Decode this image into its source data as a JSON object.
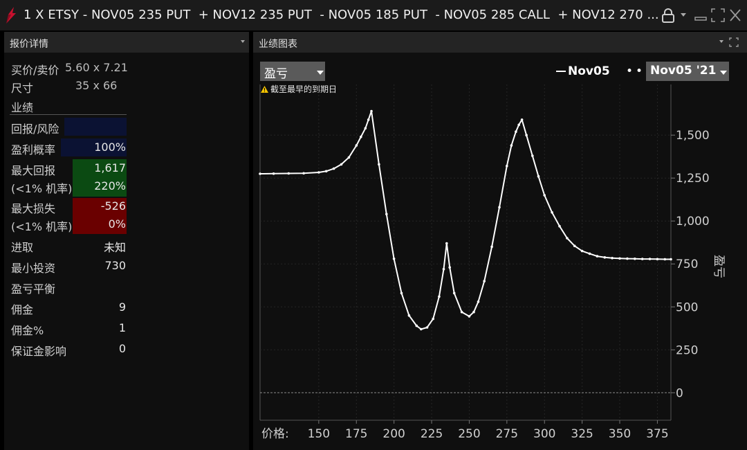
{
  "window": {
    "title": "1 X ETSY - NOV05 235 PUT  + NOV12 235 PUT  - NOV05 185 PUT  - NOV05 285 CALL  + NOV12 270 ..."
  },
  "left_panel": {
    "header": "报价详情",
    "bid_ask_label": "买价/卖价",
    "bid_ask_value": "5.60 x 7.21",
    "size_label": "尺寸",
    "size_value": "35 x 66",
    "performance_label": "业绩",
    "return_risk_label": "回报/风险",
    "return_risk_value": "",
    "prob_profit_label": "盈利概率",
    "prob_profit_value": "100%",
    "max_return_label": "最大回报",
    "max_return_value": "1,617",
    "max_return_prob_label": "(<1% 机率)",
    "max_return_prob_value": "220%",
    "max_loss_label": "最大损失",
    "max_loss_value": "-526",
    "max_loss_prob_label": "(<1% 机率)",
    "max_loss_prob_value": "0%",
    "entry_label": "进取",
    "entry_value": "未知",
    "min_invest_label": "最小投资",
    "min_invest_value": "730",
    "breakeven_label": "盈亏平衡",
    "commission_label": "佣金",
    "commission_value": "9",
    "commission_pct_label": "佣金%",
    "commission_pct_value": "1",
    "margin_label": "保证金影响",
    "margin_value": "0"
  },
  "right_panel": {
    "header": "业绩图表",
    "metric_select": "盈亏",
    "legend_series": "Nov05",
    "date_select": "Nov05 '21",
    "warning": "截至最早的到期日"
  },
  "colors": {
    "positive_green": "#0b4a12",
    "negative_red": "#6a0000",
    "navy": "#0b1233",
    "curve": "#ffffff"
  },
  "chart_data": {
    "type": "line",
    "xlabel": "价格:",
    "ylabel": "盈亏",
    "xlim": [
      111,
      384
    ],
    "ylim": [
      -160,
      1795
    ],
    "xticks": [
      150,
      175,
      200,
      225,
      250,
      275,
      300,
      325,
      350,
      375
    ],
    "yticks": [
      0,
      250,
      500,
      750,
      1000,
      1250,
      1500
    ],
    "ytick_labels": [
      "0",
      "250",
      "500",
      "750",
      "1,000",
      "1,250",
      "1,500"
    ],
    "series": [
      {
        "name": "Nov05",
        "x": [
          111,
          120,
          130,
          140,
          150,
          155,
          160,
          165,
          170,
          175,
          178,
          181,
          183,
          185,
          190,
          195,
          200,
          205,
          210,
          215,
          218,
          222,
          226,
          230,
          233,
          235,
          237,
          240,
          245,
          250,
          253,
          256,
          260,
          265,
          270,
          275,
          278,
          281,
          283,
          285,
          288,
          292,
          296,
          300,
          305,
          310,
          315,
          320,
          325,
          330,
          335,
          340,
          345,
          350,
          355,
          360,
          365,
          370,
          375,
          380,
          384
        ],
        "y": [
          1275,
          1276,
          1277,
          1278,
          1283,
          1290,
          1305,
          1330,
          1370,
          1440,
          1490,
          1540,
          1590,
          1640,
          1330,
          1040,
          780,
          580,
          450,
          390,
          370,
          380,
          430,
          560,
          720,
          870,
          730,
          580,
          470,
          445,
          470,
          530,
          650,
          850,
          1080,
          1320,
          1440,
          1520,
          1560,
          1590,
          1500,
          1380,
          1260,
          1150,
          1050,
          970,
          900,
          855,
          825,
          810,
          795,
          788,
          784,
          782,
          781,
          780,
          779,
          779,
          778,
          777,
          777
        ]
      }
    ]
  }
}
